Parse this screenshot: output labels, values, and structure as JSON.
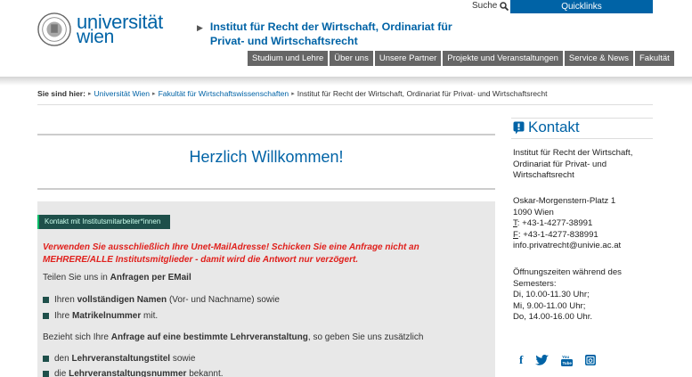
{
  "header": {
    "logo_line1": "universität",
    "logo_line2": "wien",
    "institute_title": "Institut für Recht der Wirtschaft, Ordinariat für Privat- und Wirtschaftsrecht",
    "search_label": "Suche",
    "quicklinks_label": "Quicklinks"
  },
  "nav": {
    "items": [
      "Studium und Lehre",
      "Über uns",
      "Unsere Partner",
      "Projekte und Veranstaltungen",
      "Service & News",
      "Fakultät"
    ]
  },
  "breadcrumb": {
    "label": "Sie sind hier:",
    "items": [
      "Universität Wien",
      "Fakultät für Wirtschaftswissenschaften"
    ],
    "current": "Institut für Recht der Wirtschaft, Ordinariat für Privat- und Wirtschaftsrecht"
  },
  "main": {
    "welcome": "Herzlich Willkommen!",
    "contact_button": "Kontakt mit Institutsmitarbeiter*innen",
    "warning": "Verwenden Sie ausschließlich Ihre Unet-MailAdresse! Schicken Sie eine Anfrage nicht an MEHRERE/ALLE Institutsmitglieder - damit wird die Antwort nur verzögert.",
    "p1_prefix": "Teilen Sie uns in",
    "p1_bold": "Anfragen per EMail",
    "list1": [
      {
        "pre": "Ihren",
        "bold": "vollständigen Namen",
        "post": "(Vor- und Nachname) sowie"
      },
      {
        "pre": "Ihre",
        "bold": "Matrikelnummer",
        "post": "mit."
      }
    ],
    "p2_prefix": "Bezieht sich Ihre",
    "p2_bold": "Anfrage auf eine bestimmte Lehrveranstaltung",
    "p2_suffix": ", so geben Sie uns zusätzlich",
    "list2": [
      {
        "pre": "den",
        "bold": "Lehrveranstaltungstitel",
        "post": "sowie"
      },
      {
        "pre": "die",
        "bold": "Lehrveranstaltungsnummer",
        "post": "bekannt."
      }
    ]
  },
  "sidebar": {
    "title": "Kontakt",
    "org_lines": [
      "Institut für Recht der Wirtschaft,",
      "Ordinariat für Privat- und",
      "Wirtschaftsrecht"
    ],
    "address_lines": [
      "Oskar-Morgenstern-Platz 1",
      "1090 Wien"
    ],
    "phone_label": "T",
    "phone": ": +43-1-4277-38991",
    "fax_label": "F",
    "fax": ": +43-1-4277-838991",
    "email": "info.privatrecht@univie.ac.at",
    "hours_lines": [
      "Öffnungszeiten während des",
      "Semesters:",
      "Di, 10.00-11.30 Uhr;",
      "Mi, 9.00-11.00 Uhr;",
      "Do, 14.00-16.00 Uhr."
    ],
    "social_icons": [
      "facebook-icon",
      "twitter-icon",
      "youtube-icon",
      "instagram-icon"
    ]
  },
  "colors": {
    "brand_blue": "#0063a6",
    "nav_gray": "#666666",
    "warning_red": "#e0201c",
    "dark_green": "#1e4f4a"
  }
}
